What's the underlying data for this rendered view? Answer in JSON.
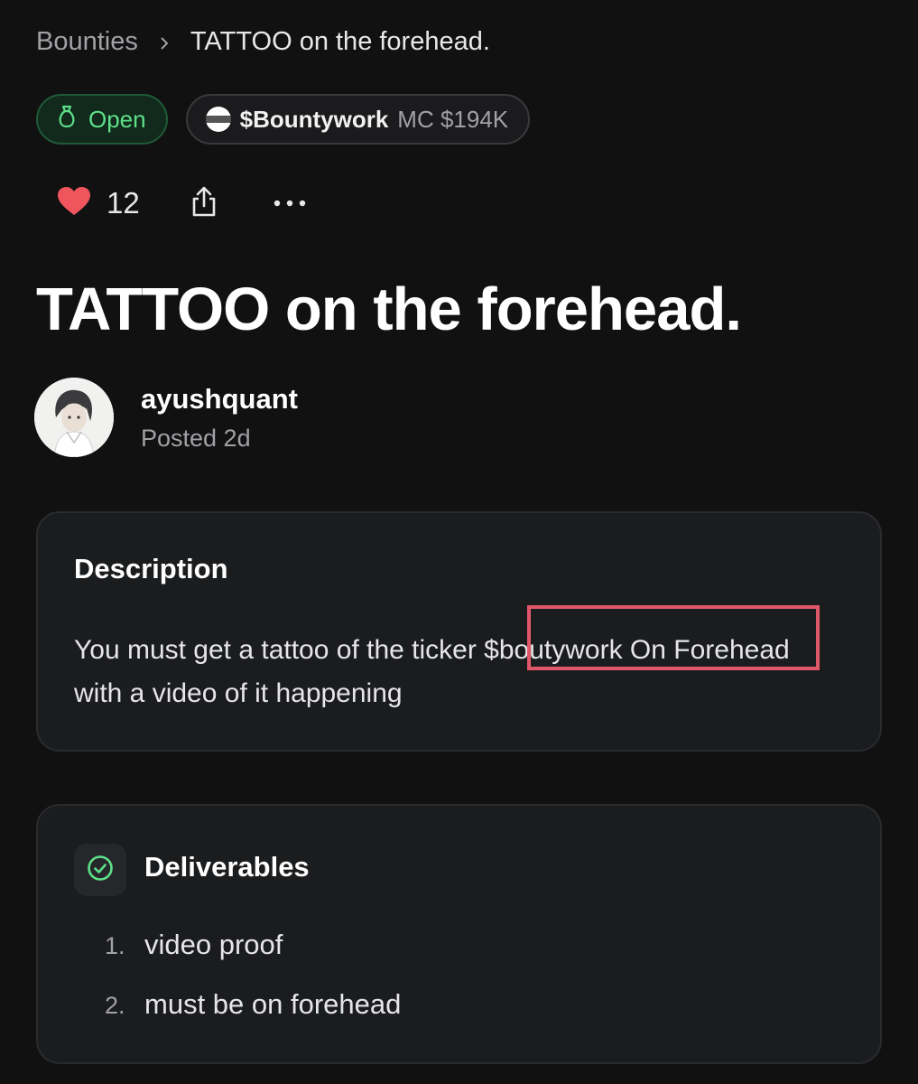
{
  "breadcrumb": {
    "parent": "Bounties",
    "current": "TATTOO on the forehead."
  },
  "status": {
    "label": "Open",
    "color": "#5ee08a",
    "icon": "money-bag-icon"
  },
  "token": {
    "ticker": "$Bountywork",
    "market_cap": "MC $194K"
  },
  "actions": {
    "likes": "12",
    "like_icon": "heart-icon",
    "share_icon": "share-icon",
    "more_icon": "more-dots-icon",
    "like_color": "#f0555e"
  },
  "title": "TATTOO on the forehead.",
  "author": {
    "name": "ayushquant",
    "posted": "Posted 2d"
  },
  "description": {
    "heading": "Description",
    "body": "You must get a tattoo of the ticker $boutywork On Forehead with a video of it happening"
  },
  "deliverables": {
    "heading": "Deliverables",
    "icon": "check-circle-icon",
    "items": [
      {
        "num": "1.",
        "text": "video proof"
      },
      {
        "num": "2.",
        "text": "must be on forehead"
      }
    ]
  }
}
